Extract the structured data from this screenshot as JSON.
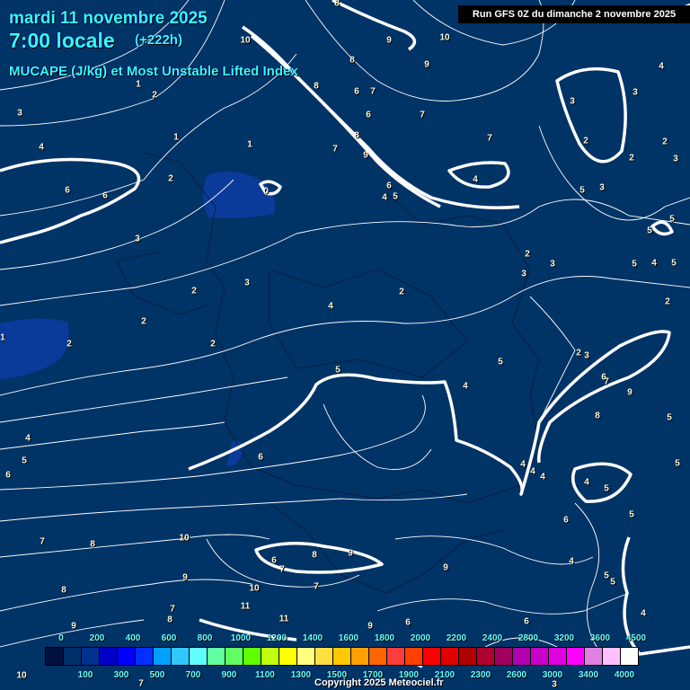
{
  "header": {
    "date": "mardi 11 novembre 2025",
    "time": "7:00 locale",
    "lead": "(+222h)",
    "parameter": "MUCAPE (J/kg) et Most Unstable Lifted Index",
    "run": "Run GFS 0Z du dimanche 2 novembre 2025"
  },
  "map": {
    "background_color": "#003366",
    "contour_color": "#ffffff",
    "contour_labels": [
      "8",
      "10",
      "9",
      "10",
      "8",
      "9",
      "4",
      "1",
      "2",
      "8",
      "6",
      "7",
      "3",
      "6",
      "7",
      "3",
      "3",
      "1",
      "1",
      "8",
      "7",
      "4",
      "2",
      "2",
      "7",
      "9",
      "2",
      "3",
      "2",
      "0",
      "4",
      "6",
      "6",
      "6",
      "5",
      "3",
      "4",
      "5",
      "5",
      "5",
      "3",
      "2",
      "3",
      "5",
      "4",
      "5",
      "3",
      "3",
      "2",
      "2",
      "2",
      "4",
      "2",
      "1",
      "2",
      "2",
      "2",
      "3",
      "5",
      "5",
      "6",
      "7",
      "9",
      "4",
      "8",
      "5",
      "4",
      "5",
      "6",
      "4",
      "4",
      "5",
      "6",
      "4",
      "4",
      "5",
      "5",
      "6",
      "7",
      "8",
      "10",
      "6",
      "8",
      "9",
      "7",
      "9",
      "4",
      "9",
      "8",
      "10",
      "7",
      "5",
      "5",
      "7",
      "11",
      "11",
      "4",
      "8",
      "9",
      "9",
      "6",
      "6",
      "10",
      "7",
      "3"
    ]
  },
  "legend": {
    "colors": [
      "#001040",
      "#00306a",
      "#003090",
      "#0000c8",
      "#0000ff",
      "#0030ff",
      "#00a0ff",
      "#30c8ff",
      "#60ffff",
      "#60ffa0",
      "#60ff60",
      "#60ff00",
      "#c0ff10",
      "#ffff00",
      "#ffff80",
      "#ffe040",
      "#ffc800",
      "#ffa000",
      "#ff6400",
      "#ff3c3c",
      "#ff4000",
      "#ff0000",
      "#e00000",
      "#b00000",
      "#b00030",
      "#a00060",
      "#b000b0",
      "#c800c8",
      "#e000e0",
      "#ff00ff",
      "#e080e0",
      "#ffc0ff",
      "#ffffff"
    ],
    "top_ticks": [
      "0",
      "200",
      "400",
      "600",
      "800",
      "1000",
      "1200",
      "1400",
      "1600",
      "1800",
      "2000",
      "2200",
      "2400",
      "2800",
      "3200",
      "3600",
      "4500"
    ],
    "bottom_ticks": [
      "100",
      "300",
      "500",
      "700",
      "900",
      "1100",
      "1300",
      "1500",
      "1700",
      "1900",
      "2100",
      "2300",
      "2600",
      "3000",
      "3400",
      "4000"
    ]
  },
  "footer": {
    "copyright": "Copyright 2025 Meteociel.fr"
  }
}
